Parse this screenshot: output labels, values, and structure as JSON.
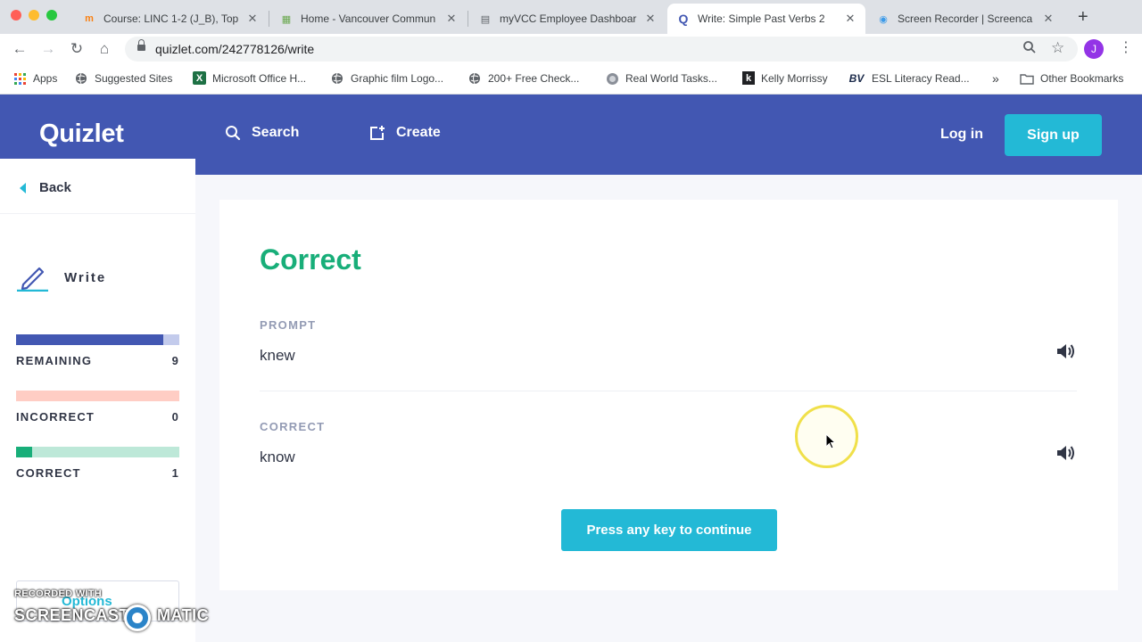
{
  "browser": {
    "tabs": [
      {
        "title": "Course: LINC 1-2 (J_B), Top",
        "favicon": "m",
        "favicon_color": "#f98012"
      },
      {
        "title": "Home - Vancouver Commun",
        "favicon": "▦",
        "favicon_color": "#6aa84f"
      },
      {
        "title": "myVCC Employee Dashboar",
        "favicon": "▤",
        "favicon_color": "#5f6368"
      },
      {
        "title": "Write: Simple Past Verbs 2",
        "favicon": "Q",
        "favicon_color": "#4257b2"
      },
      {
        "title": "Screen Recorder | Screenca",
        "favicon": "◉",
        "favicon_color": "#3d9be9"
      }
    ],
    "url": "quizlet.com/242778126/write",
    "profile_initial": "J",
    "bookmarks": [
      {
        "label": "Apps",
        "icon": "apps-grid-icon"
      },
      {
        "label": "Suggested Sites",
        "icon": "globe-icon"
      },
      {
        "label": "Microsoft Office H...",
        "icon": "excel-icon"
      },
      {
        "label": "Graphic film Logo...",
        "icon": "globe-icon"
      },
      {
        "label": "200+ Free Check...",
        "icon": "globe-icon"
      },
      {
        "label": "Real World Tasks...",
        "icon": "site-icon"
      },
      {
        "label": "Kelly Morrissy",
        "icon": "k-icon"
      },
      {
        "label": "ESL Literacy Read...",
        "icon": "bv-icon"
      }
    ],
    "bookmarks_overflow": "»",
    "other_bookmarks": "Other Bookmarks"
  },
  "header": {
    "logo": "Quizlet",
    "search": "Search",
    "create": "Create",
    "login": "Log in",
    "signup": "Sign up"
  },
  "sidebar": {
    "back": "Back",
    "mode": "Write",
    "progress": [
      {
        "label": "REMAINING",
        "count": "9",
        "fraction": 0.9,
        "fill_color": "#4257b2",
        "track_color": "#c3cbec"
      },
      {
        "label": "INCORRECT",
        "count": "0",
        "fraction": 0.0,
        "fill_color": "#ff725b",
        "track_color": "#ffcdc4"
      },
      {
        "label": "CORRECT",
        "count": "1",
        "fraction": 0.1,
        "fill_color": "#18ae79",
        "track_color": "#bde8d8"
      }
    ],
    "options": "Options"
  },
  "main": {
    "result": "Correct",
    "prompt_label": "PROMPT",
    "prompt_value": "knew",
    "correct_label": "CORRECT",
    "correct_value": "know",
    "continue": "Press any key to continue"
  },
  "watermark": {
    "top": "RECORDED WITH",
    "left": "SCREENCAST",
    "right": "MATIC"
  },
  "colors": {
    "brand": "#4257b2",
    "accent": "#23b9d6",
    "success": "#18ae79"
  }
}
